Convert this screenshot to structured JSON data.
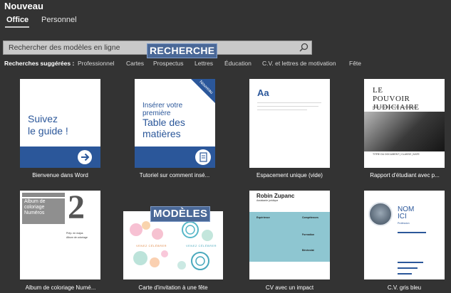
{
  "header": {
    "title": "Nouveau",
    "tabs": [
      {
        "label": "Office",
        "active": true
      },
      {
        "label": "Personnel",
        "active": false
      }
    ]
  },
  "search": {
    "placeholder": "Rechercher des modèles en ligne",
    "value": "",
    "icon": "search-icon"
  },
  "overlays": {
    "recherche": "RECHERCHE",
    "modeles": "MODÈLES"
  },
  "suggestions": {
    "label": "Recherches suggérées :",
    "items": [
      "Professionnel",
      "Cartes",
      "Prospectus",
      "Lettres",
      "Éducation",
      "C.V. et lettres de motivation",
      "Fête"
    ]
  },
  "templates": [
    {
      "label": "Bienvenue dans Word",
      "preview": {
        "line1": "Suivez",
        "line2": "le guide !"
      }
    },
    {
      "label": "Tutoriel sur comment insé...",
      "preview": {
        "small1": "Insérer votre",
        "small2": "première",
        "big1": "Table des",
        "big2": "matières",
        "corner": "Nouveau"
      }
    },
    {
      "label": "Espacement unique (vide)",
      "preview": {
        "aa": "Aa"
      }
    },
    {
      "label": "Rapport d'étudiant avec p...",
      "preview": {
        "line1": "LE",
        "line2": "POUVOIR",
        "line3": "JUDICIAIRE",
        "sub": "ROLE ET STRUCTURE DU TRIBUNAL",
        "foot": "TITRE DU DOCUMENT | CLASSE | DATE"
      }
    },
    {
      "label": "Album de coloriage Numé...",
      "preview": {
        "line1": "Album de",
        "line2": "coloriage",
        "line3": "Numéros",
        "digit": "2",
        "caption1": "Prép. en majus",
        "caption2": "Album de coloriage"
      }
    },
    {
      "label": "Carte d'invitation à une fête",
      "preview": {
        "text": "VENEZ CÉLÉBRER"
      }
    },
    {
      "label": "CV avec un impact",
      "preview": {
        "name": "Robin Zupanc",
        "sub": "Assistante juridique",
        "s1": "Expérience",
        "s2": "Compétences",
        "s3": "Formation",
        "s4": "Bénévolat"
      }
    },
    {
      "label": "C.V. gris bleu",
      "preview": {
        "line1": "NOM",
        "line2": "ICI",
        "title": "Profession"
      }
    }
  ],
  "colors": {
    "background": "#333333",
    "word_blue": "#2b579a",
    "overlay": "#4a6897",
    "cv_teal": "#8ec6d1"
  }
}
